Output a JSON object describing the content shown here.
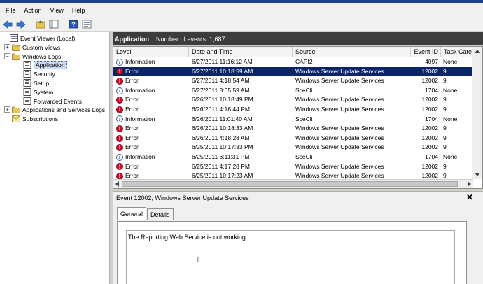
{
  "menu": [
    "File",
    "Action",
    "View",
    "Help"
  ],
  "toolbar": [
    "back-icon",
    "forward-icon",
    "up-folder-icon",
    "show-hide-console-tree-icon",
    "help-icon",
    "properties-icon"
  ],
  "tree": {
    "root": "Event Viewer (Local)",
    "custom_views": "Custom Views",
    "windows_logs": "Windows Logs",
    "logs": [
      "Application",
      "Security",
      "Setup",
      "System",
      "Forwarded Events"
    ],
    "apps_services": "Applications and Services Logs",
    "subscriptions": "Subscriptions"
  },
  "log_header": {
    "name": "Application",
    "count_text": "Number of events: 1,687"
  },
  "columns": [
    "Level",
    "Date and Time",
    "Source",
    "Event ID",
    "Task Cate"
  ],
  "events": [
    {
      "level": "Information",
      "datetime": "6/27/2011 11:16:12 AM",
      "source": "CAPI2",
      "event_id": "4097",
      "task": "None"
    },
    {
      "level": "Error",
      "datetime": "6/27/2011 10:18:59 AM",
      "source": "Windows Server Update Services",
      "event_id": "12002",
      "task": "9"
    },
    {
      "level": "Error",
      "datetime": "6/27/2011 4:18:54 AM",
      "source": "Windows Server Update Services",
      "event_id": "12002",
      "task": "9"
    },
    {
      "level": "Information",
      "datetime": "6/27/2011 3:05:59 AM",
      "source": "SceCli",
      "event_id": "1704",
      "task": "None"
    },
    {
      "level": "Error",
      "datetime": "6/26/2011 10:18:49 PM",
      "source": "Windows Server Update Services",
      "event_id": "12002",
      "task": "9"
    },
    {
      "level": "Error",
      "datetime": "6/26/2011 4:18:44 PM",
      "source": "Windows Server Update Services",
      "event_id": "12002",
      "task": "9"
    },
    {
      "level": "Information",
      "datetime": "6/26/2011 11:01:40 AM",
      "source": "SceCli",
      "event_id": "1704",
      "task": "None"
    },
    {
      "level": "Error",
      "datetime": "6/26/2011 10:18:33 AM",
      "source": "Windows Server Update Services",
      "event_id": "12002",
      "task": "9"
    },
    {
      "level": "Error",
      "datetime": "6/26/2011 4:18:28 AM",
      "source": "Windows Server Update Services",
      "event_id": "12002",
      "task": "9"
    },
    {
      "level": "Error",
      "datetime": "6/25/2011 10:17:33 PM",
      "source": "Windows Server Update Services",
      "event_id": "12002",
      "task": "9"
    },
    {
      "level": "Information",
      "datetime": "6/25/2011 6:11:31 PM",
      "source": "SceCli",
      "event_id": "1704",
      "task": "None"
    },
    {
      "level": "Error",
      "datetime": "6/25/2011 4:17:28 PM",
      "source": "Windows Server Update Services",
      "event_id": "12002",
      "task": "9"
    },
    {
      "level": "Error",
      "datetime": "6/25/2011 10:17:23 AM",
      "source": "Windows Server Update Services",
      "event_id": "12002",
      "task": "9"
    }
  ],
  "selected_index": 1,
  "details": {
    "title": "Event 12002, Windows Server Update Services",
    "close": "✕",
    "tabs": [
      "General",
      "Details"
    ],
    "description": "The Reporting Web Service is not working."
  },
  "colors": {
    "selection": "#0a246a",
    "error": "#c8102e",
    "info": "#3a5ea8"
  }
}
